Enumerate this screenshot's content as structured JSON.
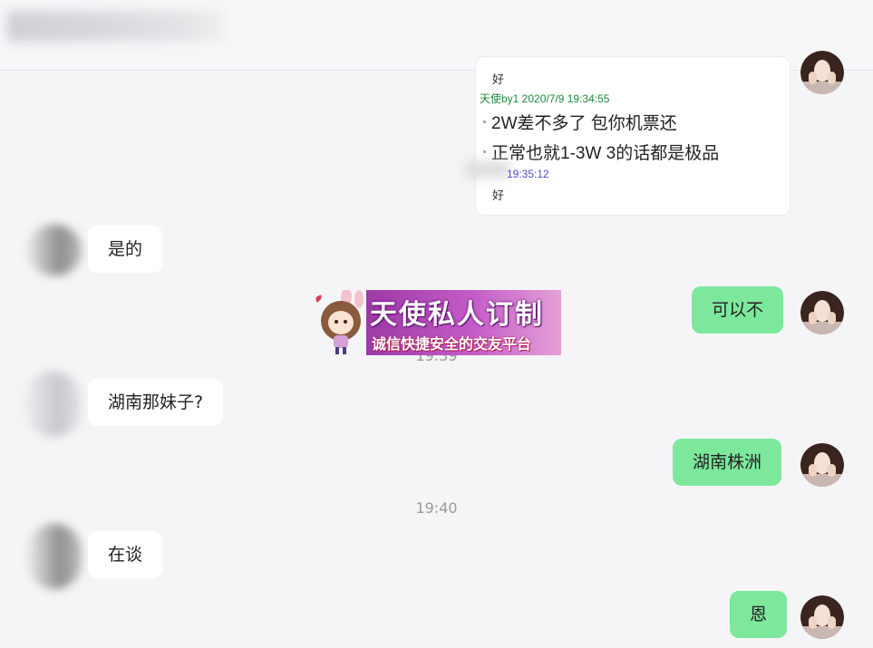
{
  "quote": {
    "top_line": "好",
    "meta": "天使by1 2020/7/9 19:34:55",
    "lines": [
      "2W差不多了 包你机票还",
      "正常也就1-3W  3的话都是极品"
    ],
    "meta2": "19:35:12",
    "bottom_line": "好"
  },
  "messages": {
    "m1": "是的",
    "m2": "可以不",
    "m3": "湖南那妹子?",
    "m4": "湖南株洲",
    "m5": "在谈",
    "m6": "恩"
  },
  "times": {
    "t1": "19:39",
    "t2": "19:40"
  },
  "banner": {
    "title": "天使私人订制",
    "subtitle": "诚信快捷安全的交友平台"
  },
  "colors": {
    "sent_bubble": "#7de89c",
    "received_bubble": "#ffffff",
    "background": "#f5f5f7"
  }
}
